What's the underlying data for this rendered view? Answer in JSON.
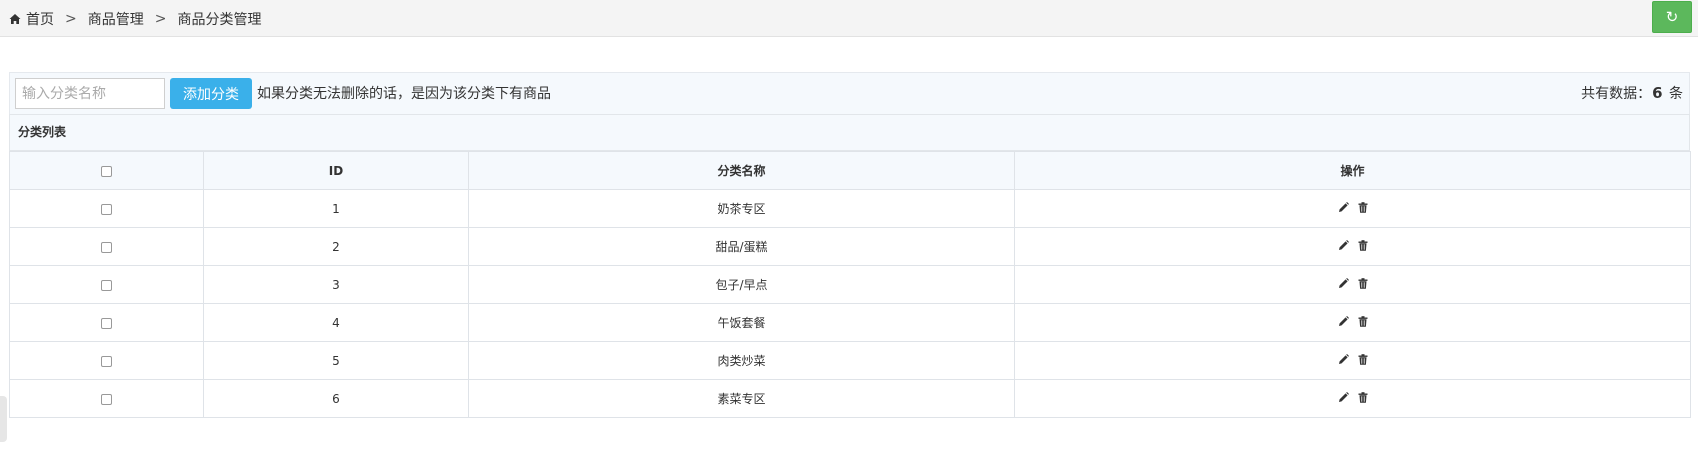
{
  "breadcrumb": {
    "home": "首页",
    "separator": ">",
    "level2": "商品管理",
    "level3": "商品分类管理"
  },
  "icons": {
    "home": "home-icon",
    "refresh": "refresh-icon",
    "edit": "pencil-icon",
    "delete": "trash-icon"
  },
  "colors": {
    "refresh_button": "#5cb85c",
    "add_button": "#3ab0ea"
  },
  "toolbar": {
    "search_placeholder": "输入分类名称",
    "search_value": "",
    "add_label": "添加分类",
    "hint": "如果分类无法删除的话，是因为该分类下有商品",
    "total_label": "共有数据：",
    "total_count": "6",
    "total_unit": "条"
  },
  "list": {
    "title": "分类列表",
    "columns": [
      "",
      "ID",
      "分类名称",
      "操作"
    ],
    "rows": [
      {
        "id": "1",
        "name": "奶茶专区"
      },
      {
        "id": "2",
        "name": "甜品/蛋糕"
      },
      {
        "id": "3",
        "name": "包子/早点"
      },
      {
        "id": "4",
        "name": "午饭套餐"
      },
      {
        "id": "5",
        "name": "肉类炒菜"
      },
      {
        "id": "6",
        "name": "素菜专区"
      }
    ]
  }
}
